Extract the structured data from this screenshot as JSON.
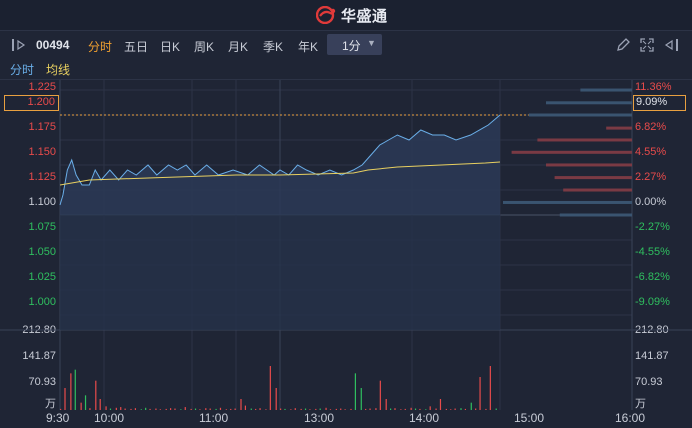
{
  "brand": {
    "name": "华盛通"
  },
  "toolbar": {
    "stock_code": "00494",
    "tabs": [
      "分时",
      "五日",
      "日K",
      "周K",
      "月K",
      "季K",
      "年K"
    ],
    "active_tab": "分时",
    "interval": "1分"
  },
  "subtabs": {
    "time": "分时",
    "avg": "均线"
  },
  "colors": {
    "up": "#e84b4b",
    "down": "#2fbf5f",
    "price_line": "#6aaee8",
    "avg_line": "#e8d060",
    "accent": "#f0a030"
  },
  "price_axis": {
    "labels": [
      "1.225",
      "1.200",
      "1.175",
      "1.150",
      "1.125",
      "1.100",
      "1.075",
      "1.050",
      "1.025",
      "1.000"
    ],
    "current": "1.200"
  },
  "pct_axis": {
    "labels": [
      "11.36%",
      "9.09%",
      "6.82%",
      "4.55%",
      "2.27%",
      "0.00%",
      "-2.27%",
      "-4.55%",
      "-6.82%",
      "-9.09%"
    ]
  },
  "volume_axis": {
    "labels": [
      "212.80",
      "141.87",
      "70.93"
    ],
    "unit": "万"
  },
  "time_axis": [
    "9:30",
    "10:00",
    "11:00",
    "13:00",
    "14:00",
    "15:00",
    "16:00"
  ],
  "chart_data": {
    "type": "line",
    "prev_close": 1.1,
    "ylim": [
      0.98,
      1.23
    ],
    "price": [
      [
        0,
        1.11
      ],
      [
        2,
        1.12
      ],
      [
        5,
        1.145
      ],
      [
        8,
        1.155
      ],
      [
        11,
        1.14
      ],
      [
        15,
        1.13
      ],
      [
        20,
        1.13
      ],
      [
        24,
        1.145
      ],
      [
        28,
        1.135
      ],
      [
        34,
        1.145
      ],
      [
        40,
        1.135
      ],
      [
        46,
        1.145
      ],
      [
        52,
        1.14
      ],
      [
        60,
        1.15
      ],
      [
        66,
        1.14
      ],
      [
        74,
        1.15
      ],
      [
        80,
        1.145
      ],
      [
        86,
        1.15
      ],
      [
        92,
        1.14
      ],
      [
        100,
        1.15
      ],
      [
        108,
        1.14
      ],
      [
        118,
        1.145
      ],
      [
        128,
        1.14
      ],
      [
        136,
        1.15
      ],
      [
        146,
        1.14
      ],
      [
        150,
        1.145
      ],
      [
        156,
        1.14
      ],
      [
        162,
        1.15
      ],
      [
        168,
        1.145
      ],
      [
        176,
        1.14
      ],
      [
        184,
        1.145
      ],
      [
        192,
        1.14
      ],
      [
        200,
        1.145
      ],
      [
        206,
        1.15
      ],
      [
        212,
        1.16
      ],
      [
        218,
        1.17
      ],
      [
        224,
        1.175
      ],
      [
        230,
        1.18
      ],
      [
        238,
        1.175
      ],
      [
        246,
        1.185
      ],
      [
        254,
        1.18
      ],
      [
        262,
        1.18
      ],
      [
        270,
        1.175
      ],
      [
        280,
        1.18
      ],
      [
        292,
        1.19
      ],
      [
        300,
        1.2
      ]
    ],
    "avg": [
      [
        0,
        1.13
      ],
      [
        20,
        1.135
      ],
      [
        60,
        1.137
      ],
      [
        120,
        1.14
      ],
      [
        150,
        1.14
      ],
      [
        200,
        1.142
      ],
      [
        210,
        1.145
      ],
      [
        230,
        1.148
      ],
      [
        260,
        1.15
      ],
      [
        290,
        1.152
      ],
      [
        300,
        1.153
      ]
    ],
    "volume": [
      3,
      60,
      100,
      110,
      20,
      40,
      5,
      80,
      30,
      10,
      4,
      6,
      8,
      4,
      3,
      5,
      2,
      6,
      3,
      4,
      2,
      3,
      5,
      4,
      2,
      8,
      3,
      4,
      2,
      5,
      4,
      3,
      6,
      2,
      3,
      4,
      30,
      12,
      4,
      3,
      5,
      2,
      120,
      60,
      4,
      3,
      2,
      5,
      3,
      4,
      2,
      3,
      4,
      6,
      2,
      3,
      4,
      2,
      3,
      100,
      60,
      3,
      4,
      5,
      80,
      30,
      4,
      5,
      2,
      3,
      6,
      4,
      3,
      2,
      10,
      4,
      30,
      3,
      2,
      4,
      5,
      3,
      20,
      4,
      90,
      3,
      120,
      4
    ],
    "order_book_bars": [
      {
        "pct": 11.36,
        "width": 0.3,
        "color": "#3a5470"
      },
      {
        "pct": 10.2,
        "width": 0.5,
        "color": "#3a5470"
      },
      {
        "pct": 9.09,
        "width": 0.6,
        "color": "#3a5470"
      },
      {
        "pct": 7.9,
        "width": 0.15,
        "color": "#7a3a44"
      },
      {
        "pct": 6.82,
        "width": 0.55,
        "color": "#7a3a44"
      },
      {
        "pct": 5.7,
        "width": 0.7,
        "color": "#7a3a44"
      },
      {
        "pct": 4.55,
        "width": 0.5,
        "color": "#7a3a44"
      },
      {
        "pct": 3.4,
        "width": 0.45,
        "color": "#7a3a44"
      },
      {
        "pct": 2.27,
        "width": 0.4,
        "color": "#7a3a44"
      },
      {
        "pct": 1.14,
        "width": 0.75,
        "color": "#3a5470"
      },
      {
        "pct": 0.0,
        "width": 0.42,
        "color": "#3a5470"
      }
    ]
  }
}
